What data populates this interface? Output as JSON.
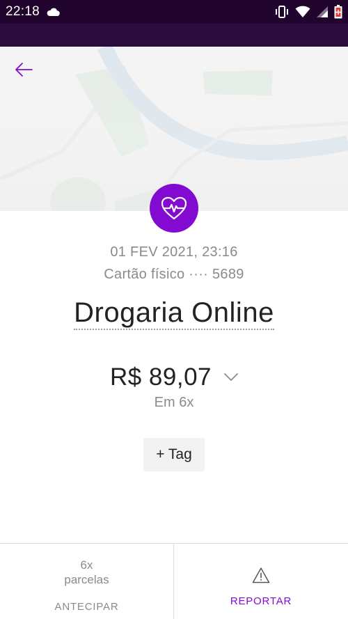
{
  "status_bar": {
    "time": "22:18",
    "icons": [
      "cloud-icon",
      "vibrate-icon",
      "wifi-icon",
      "signal-icon",
      "battery-icon"
    ]
  },
  "colors": {
    "brand_purple": "#820ad1",
    "status_bar_bg": "#21052e",
    "header_bg": "#2b0a3d"
  },
  "header": {
    "back_icon": "arrow-left-icon"
  },
  "transaction": {
    "category_icon": "heart-pulse-icon",
    "datetime": "01 FEV 2021, 23:16",
    "card": "Cartão físico ···· 5689",
    "merchant": "Drogaria Online",
    "amount": "R$ 89,07",
    "installments": "Em 6x",
    "tag_button_label": "+ Tag"
  },
  "bottom_actions": {
    "installment_count": "6x",
    "installment_word": "parcelas",
    "antecipar_label": "ANTECIPAR",
    "report_icon": "warning-triangle-icon",
    "report_label": "REPORTAR"
  }
}
